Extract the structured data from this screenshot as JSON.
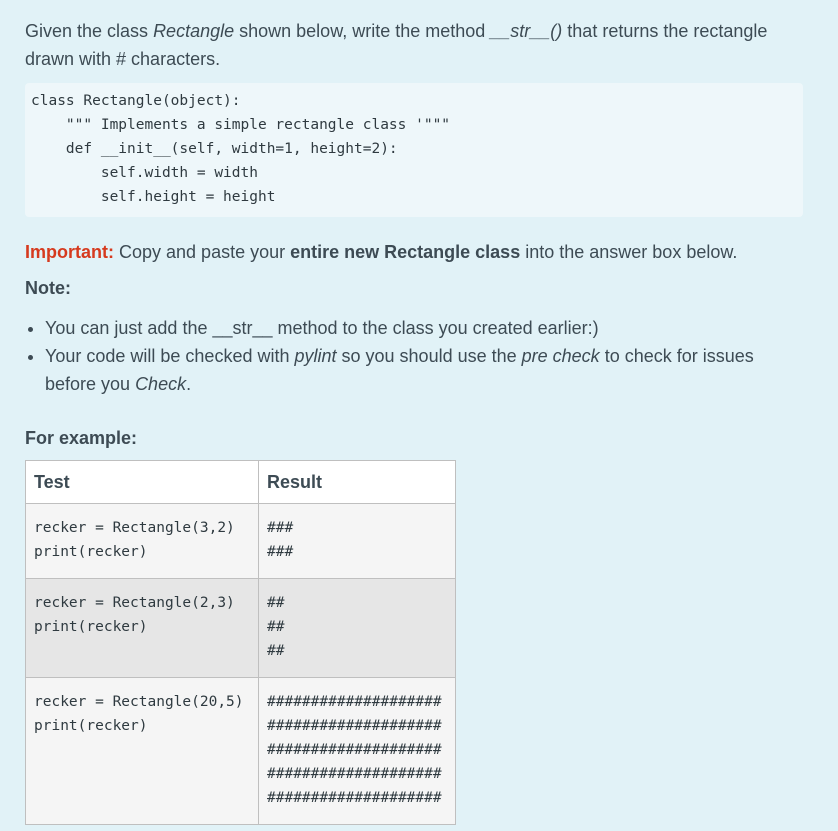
{
  "intro": {
    "part1": "Given the class ",
    "class_name": "Rectangle",
    "part2": " shown below, write the method ",
    "method_name": "__str__()",
    "part3": " that returns the rectangle drawn with # characters."
  },
  "code": [
    "class Rectangle(object):",
    "    \"\"\" Implements a simple rectangle class '\"\"\"",
    "    def __init__(self, width=1, height=2):",
    "        self.width = width",
    "        self.height = height"
  ],
  "important": {
    "label": "Important:",
    "text1": " Copy and paste your ",
    "bold": "entire new Rectangle class",
    "text2": " into the answer box below."
  },
  "note": {
    "title": "Note:",
    "item1": "You can just add the __str__ method to the class you created earlier:)",
    "item2_a": "Your code will be checked with ",
    "item2_pylint": "pylint",
    "item2_b": " so you should use the ",
    "item2_precheck": "pre check",
    "item2_c": " to check for issues before you ",
    "item2_check": "Check",
    "item2_d": "."
  },
  "example": {
    "title": "For example:",
    "headers": {
      "test": "Test",
      "result": "Result"
    },
    "rows": [
      {
        "test": [
          "recker = Rectangle(3,2)",
          "print(recker)"
        ],
        "result": [
          "###",
          "###"
        ]
      },
      {
        "test": [
          "recker = Rectangle(2,3)",
          "print(recker)"
        ],
        "result": [
          "##",
          "##",
          "##"
        ]
      },
      {
        "test": [
          "recker = Rectangle(20,5)",
          "print(recker)"
        ],
        "result": [
          "####################",
          "####################",
          "####################",
          "####################",
          "####################"
        ]
      }
    ]
  }
}
